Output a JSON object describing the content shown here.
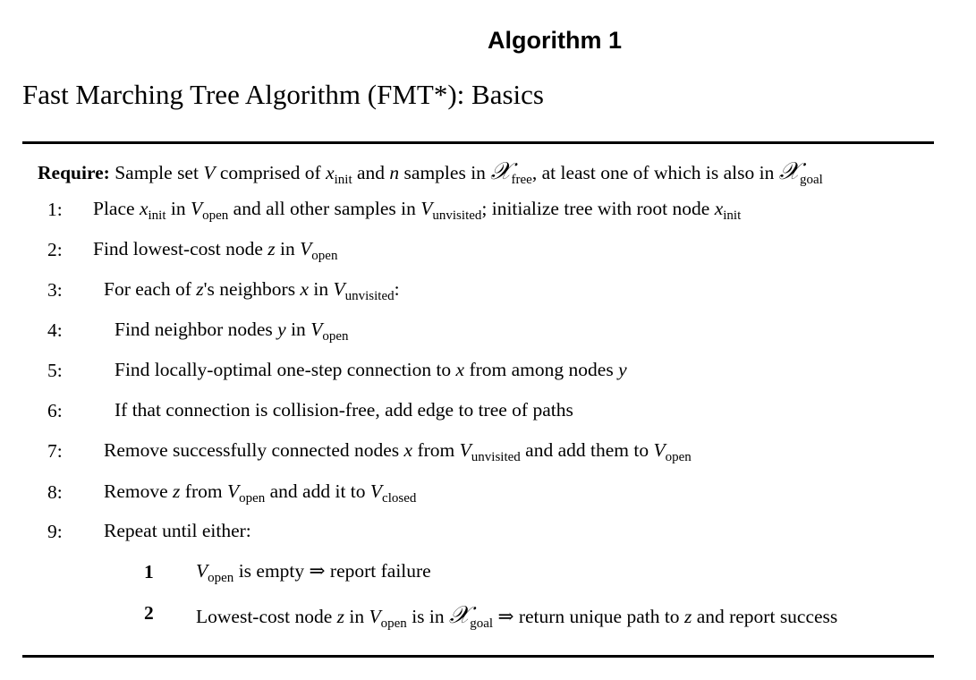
{
  "heading": "Algorithm 1",
  "title": "Fast Marching Tree Algorithm (FMT*): Basics",
  "require": {
    "label": "Require:",
    "t1": "Sample set",
    "v": "V",
    "t2": "comprised of",
    "x": "x",
    "init": "init",
    "t3": "and",
    "n": "n",
    "t4": "samples in",
    "cal": "𝒳",
    "free": "free",
    "t5": ", at least one of which is also in",
    "goal": "goal"
  },
  "steps": [
    {
      "num": "1:",
      "a": "Place",
      "x": "x",
      "init": "init",
      "b": "in",
      "V": "V",
      "open": "open",
      "c": "and all other samples in",
      "unvisited": "unvisited",
      "d": "; initialize tree with root node"
    },
    {
      "num": "2:",
      "a": "Find lowest-cost node",
      "z": "z",
      "b": "in",
      "V": "V",
      "open": "open"
    },
    {
      "num": "3:",
      "a": "For each of",
      "z": "z",
      "b": "'s neighbors",
      "x": "x",
      "c": "in",
      "V": "V",
      "unvisited": "unvisited",
      "d": ":"
    },
    {
      "num": "4:",
      "a": "Find neighbor nodes",
      "y": "y",
      "b": "in",
      "V": "V",
      "open": "open"
    },
    {
      "num": "5:",
      "a": "Find locally-optimal one-step connection to",
      "x": "x",
      "b": "from among nodes",
      "y": "y"
    },
    {
      "num": "6:",
      "a": "If that connection is collision-free, add edge to tree of paths"
    },
    {
      "num": "7:",
      "a": "Remove successfully connected nodes",
      "x": "x",
      "b": "from",
      "V": "V",
      "unvisited": "unvisited",
      "c": "and add them to",
      "open": "open"
    },
    {
      "num": "8:",
      "a": "Remove",
      "z": "z",
      "b": "from",
      "V": "V",
      "open": "open",
      "c": "and add it to",
      "closed": "closed"
    },
    {
      "num": "9:",
      "a": "Repeat until either:"
    }
  ],
  "cases": [
    {
      "num": "1",
      "V": "V",
      "open": "open",
      "a": "is empty ⇒ report failure"
    },
    {
      "num": "2",
      "a": "Lowest-cost node",
      "z": "z",
      "b": "in",
      "V": "V",
      "open": "open",
      "c": "is in",
      "cal": "𝒳",
      "goal": "goal",
      "d": "⇒ return unique path to",
      "e": "and report success"
    }
  ]
}
